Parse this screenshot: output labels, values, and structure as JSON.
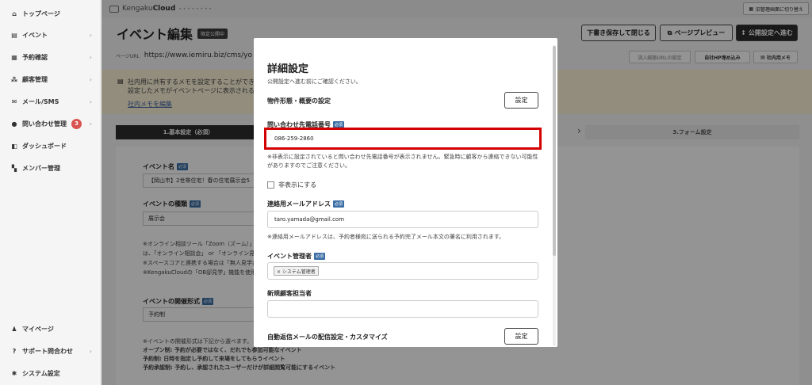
{
  "sidebar": {
    "items": [
      {
        "label": "トップページ",
        "icon": "home-icon",
        "glyph": "⌂"
      },
      {
        "label": "イベント",
        "icon": "document-icon",
        "glyph": "▤"
      },
      {
        "label": "予約確認",
        "icon": "reservation-icon",
        "glyph": "▦"
      },
      {
        "label": "顧客管理",
        "icon": "customers-icon",
        "glyph": "⁂"
      },
      {
        "label": "メール/SMS",
        "icon": "mail-icon",
        "glyph": "✉"
      },
      {
        "label": "問い合わせ管理",
        "icon": "chat-icon",
        "glyph": "●",
        "badge": "3"
      },
      {
        "label": "ダッシュボード",
        "icon": "dashboard-icon",
        "glyph": "◧"
      },
      {
        "label": "メンバー管理",
        "icon": "grid-icon",
        "glyph": "▚"
      }
    ],
    "bottom_items": [
      {
        "label": "マイページ",
        "icon": "user-icon",
        "glyph": "♟"
      },
      {
        "label": "サポート問合わせ",
        "icon": "help-icon",
        "glyph": "?"
      },
      {
        "label": "システム設定",
        "icon": "gear-icon",
        "glyph": "✱"
      }
    ],
    "chevron": "›"
  },
  "topbar": {
    "logo_prefix": "Kengaku",
    "logo_bold": "Cloud",
    "logo_tail": "• • • • • • • •",
    "admin_button": "旧管理画面に切り替え"
  },
  "header": {
    "title": "イベント編集",
    "title_tag": "限定公開中",
    "save_draft": "下書き保存して閉じる",
    "preview": "ページプレビュー",
    "publish": "公開設定へ進む"
  },
  "url_bar": {
    "label": "ページURL",
    "url": "https://www.iemiru.biz/cms/yo",
    "btn_inflow": "流入経路URLの設定",
    "btn_embed": "自社HP埋め込み",
    "btn_memo": "社内用メモ"
  },
  "memo": {
    "line1": "社内用に共有するメモを設定することができ",
    "line2": "設定したメモがイベントページに表示されるこ",
    "link": "社内メモを編集"
  },
  "steps": {
    "step1": "1.基本設定（必須）",
    "arrow": "›",
    "step3": "3.フォーム設定"
  },
  "form": {
    "event_name_label": "イベント名",
    "event_name_value": "【岡山市】2世帯住宅！春の住宅展示会5",
    "event_type_label": "イベントの種類",
    "event_type_value": "展示会",
    "note1": "※オンライン相談ツール「Zoom（ズーム）」を",
    "note2": "は、「オンライン相談会」 or 「オンライン見学",
    "note3": "※スペースコアと連携する場合は「無人見学会",
    "note4": "※KengakuCloudの「OB邸見学」機能を使用",
    "format_label": "イベントの開催形式",
    "format_value": "予約制",
    "format_note": "※イベントの開催形式は下記から選べます。",
    "open_note": "オープン制: 予約が必要ではなく、だれでも参加可能なイベント",
    "reserve_note": "予約制: 日時を指定し予約して来場をしてもらうイベント",
    "approval_note": "予約承認制: 予約し、承認されたユーザーだけが詳細閲覧可能にするイベント"
  },
  "required_tag": "必須",
  "modal": {
    "title": "詳細設定",
    "subtitle": "公開設定へ進む前にご確認ください。",
    "property_label": "物件形態・概要の設定",
    "setting_button": "設定",
    "phone_label": "問い合わせ先電話番号",
    "phone_value": "086-259-2860",
    "phone_note": "※非表示に設定されていると問い合わせ先電話番号が表示されません。緊急時に顧客から連絡できない可能性がありますのでご注意ください。",
    "hide_label": "非表示にする",
    "email_label": "連絡用メールアドレス",
    "email_value": "taro.yamada@gmail.com",
    "email_note": "※連絡用メールアドレスは、予約者様宛に送られる予約完了メール本文の署名に利用されます。",
    "manager_label": "イベント管理者",
    "manager_chip": "× システム管理者",
    "new_customer_label": "新規顧客担当者",
    "new_customer_value": "",
    "auto_reply_label": "自動返信メールの配信設定・カスタマイズ",
    "auto_reply_button": "設定"
  }
}
